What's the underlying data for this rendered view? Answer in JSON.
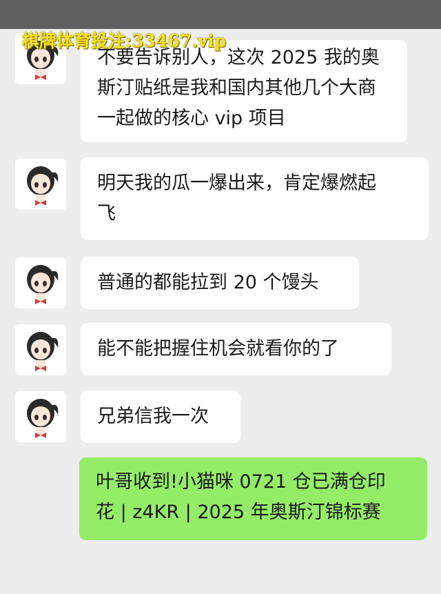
{
  "watermark": "棋牌体育投注:33467.vip",
  "messages": [
    {
      "side": "left",
      "lines": [
        "不要告诉别人，这次 2025 我的奥",
        "斯汀贴纸是我和国内其他几个大商",
        "一起做的核心 vip 项目"
      ]
    },
    {
      "side": "left",
      "lines": [
        "明天我的瓜一爆出来，肯定爆燃起",
        "飞"
      ]
    },
    {
      "side": "left",
      "lines": [
        "普通的都能拉到 20 个馒头"
      ]
    },
    {
      "side": "left",
      "lines": [
        "能不能把握住机会就看你的了"
      ]
    },
    {
      "side": "left",
      "lines": [
        "兄弟信我一次"
      ]
    },
    {
      "side": "right",
      "lines": [
        "叶哥收到!小猫咪 0721 仓已满仓印",
        "花 | z4KR | 2025 年奥斯汀锦标赛"
      ]
    }
  ],
  "colors": {
    "background": "#ededed",
    "bubble_left": "#ffffff",
    "bubble_right": "#95ec69",
    "watermark": "#f3e21f"
  }
}
